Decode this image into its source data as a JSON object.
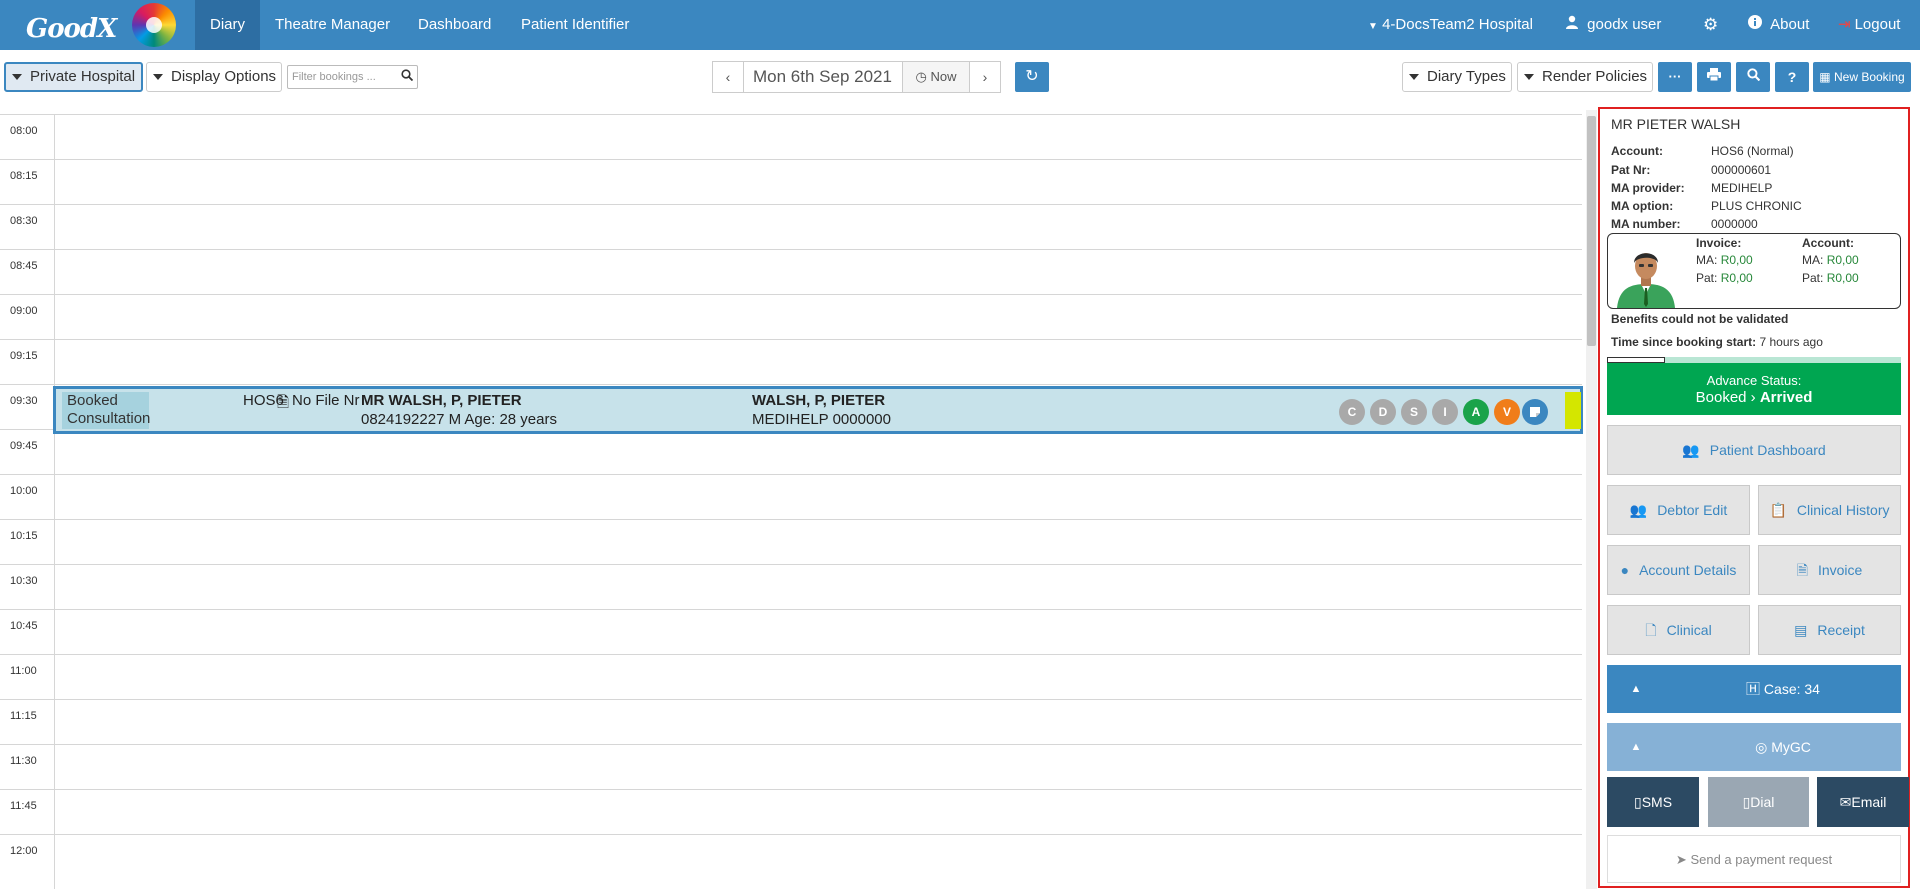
{
  "navbar": {
    "brand": "GoodX",
    "items": [
      {
        "label": "Diary",
        "active": true
      },
      {
        "label": "Theatre Manager",
        "active": false
      },
      {
        "label": "Dashboard",
        "active": false
      },
      {
        "label": "Patient Identifier",
        "active": false
      }
    ],
    "hospital": "4-DocsTeam2 Hospital",
    "user": "goodx user",
    "about": "About",
    "logout": "Logout"
  },
  "toolbar": {
    "diary": "Private Hospital",
    "display_options": "Display Options",
    "filter_placeholder": "Filter bookings ...",
    "date": "Mon 6th Sep 2021",
    "now": "Now",
    "diary_types": "Diary Types",
    "render_policies": "Render Policies",
    "new_booking": "New Booking"
  },
  "diary": {
    "times": [
      "08:00",
      "08:15",
      "08:30",
      "08:45",
      "09:00",
      "09:15",
      "09:30",
      "09:45",
      "10:00",
      "10:15",
      "10:30",
      "10:45",
      "11:00",
      "11:15",
      "11:30",
      "11:45",
      "12:00"
    ],
    "booking": {
      "status_line1": "Booked",
      "status_line2": "Consultation",
      "account": "HOS6",
      "file": "No File Nr",
      "patient": "MR WALSH, P, PIETER",
      "details": "0824192227 M Age: 28 years",
      "debtor": "WALSH, P, PIETER",
      "medical_aid": "MEDIHELP 0000000",
      "flags": [
        {
          "letter": "C",
          "color": "#a9a9a9"
        },
        {
          "letter": "D",
          "color": "#a9a9a9"
        },
        {
          "letter": "S",
          "color": "#a9a9a9"
        },
        {
          "letter": "I",
          "color": "#a9a9a9"
        },
        {
          "letter": "A",
          "color": "#1aa34a"
        },
        {
          "letter": "V",
          "color": "#f07d1a"
        }
      ]
    }
  },
  "panel": {
    "name": "MR PIETER WALSH",
    "fields": [
      {
        "label": "Account:",
        "value": "HOS6 (Normal)"
      },
      {
        "label": "Pat Nr:",
        "value": "000000601"
      },
      {
        "label": "MA provider:",
        "value": "MEDIHELP"
      },
      {
        "label": "MA option:",
        "value": "PLUS CHRONIC"
      },
      {
        "label": "MA number:",
        "value": "0000000"
      }
    ],
    "invoice_title": "Invoice:",
    "account_title": "Account:",
    "ma_label": "MA:",
    "pat_label": "Pat:",
    "invoice_ma": "R0,00",
    "invoice_pat": "R0,00",
    "account_ma": "R0,00",
    "account_pat": "R0,00",
    "benefits": "Benefits could not be validated",
    "time_label": "Time since booking start:",
    "time_value": "7 hours ago",
    "advance_label": "Advance Status:",
    "status_from": "Booked",
    "status_to": "Arrived",
    "patient_dashboard": "Patient Dashboard",
    "debtor_edit": "Debtor Edit",
    "clinical_history": "Clinical History",
    "account_details": "Account Details",
    "invoice": "Invoice",
    "clinical": "Clinical",
    "receipt": "Receipt",
    "case": "Case: 34",
    "mygc": "MyGC",
    "sms": "SMS",
    "dial": "Dial",
    "email": "Email",
    "payment_request": "Send a payment request"
  }
}
